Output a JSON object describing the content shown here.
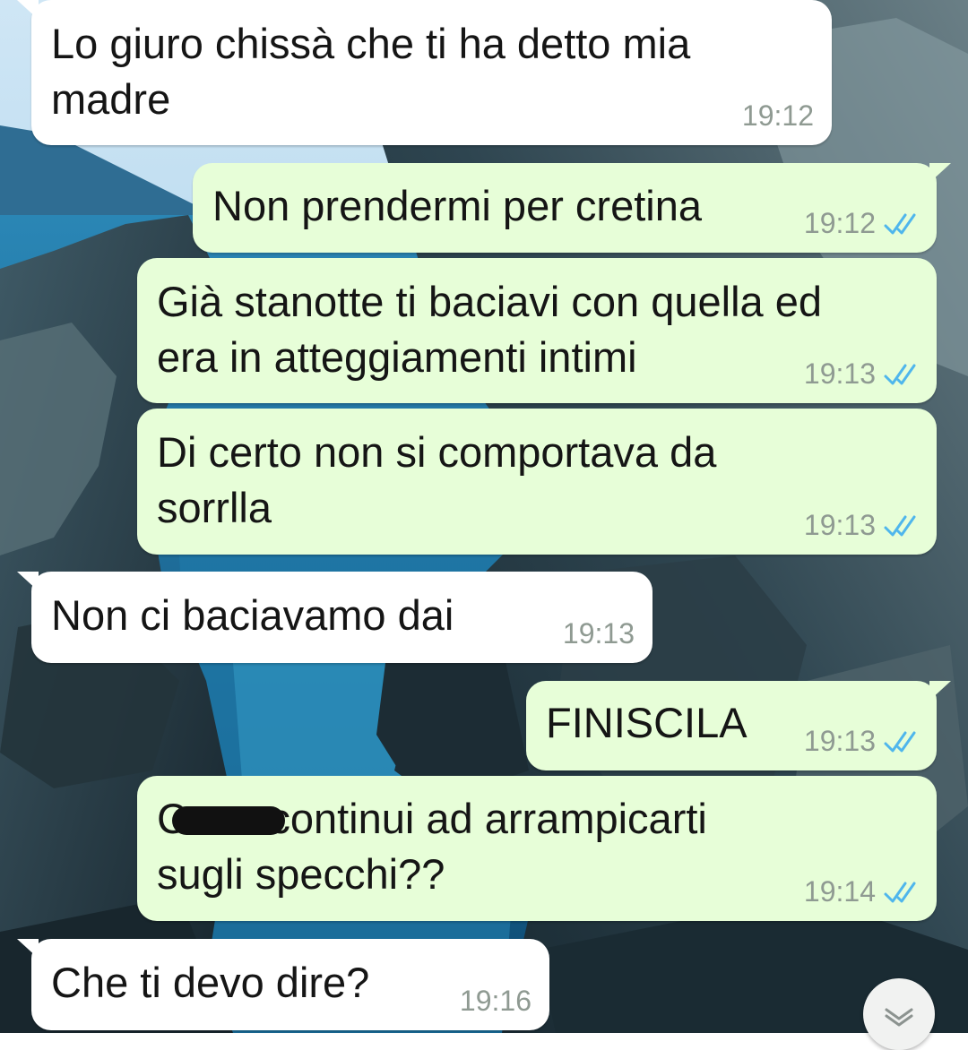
{
  "chat": {
    "messages": [
      {
        "direction": "incoming",
        "text": "Lo giuro chissà che ti ha detto mia\nmadre",
        "time": "19:12"
      },
      {
        "direction": "outgoing",
        "text": "Non prendermi per cretina",
        "time": "19:12",
        "status": "read"
      },
      {
        "direction": "outgoing",
        "text": "Già stanotte ti baciavi con quella ed\nera in atteggiamenti intimi",
        "time": "19:13",
        "status": "read"
      },
      {
        "direction": "outgoing",
        "text": "Di certo non si comportava da\nsorrlla",
        "time": "19:13",
        "status": "read"
      },
      {
        "direction": "incoming",
        "text": "Non ci baciavamo dai",
        "time": "19:13"
      },
      {
        "direction": "outgoing",
        "text": "FINISCILA",
        "time": "19:13",
        "status": "read"
      },
      {
        "direction": "outgoing",
        "text": "C        ma continui ad arrampicarti\nsugli specchi??",
        "time": "19:14",
        "status": "read"
      },
      {
        "direction": "incoming",
        "text": "Che ti devo dire?",
        "time": "19:16"
      }
    ]
  },
  "colors": {
    "incoming_bubble": "#ffffff",
    "outgoing_bubble": "#e7fed8",
    "read_ticks": "#4fb6ec",
    "timestamp": "#8f9a92"
  },
  "icons": {
    "read_status": "double-check-icon",
    "scroll_down": "chevron-double-down-icon"
  }
}
